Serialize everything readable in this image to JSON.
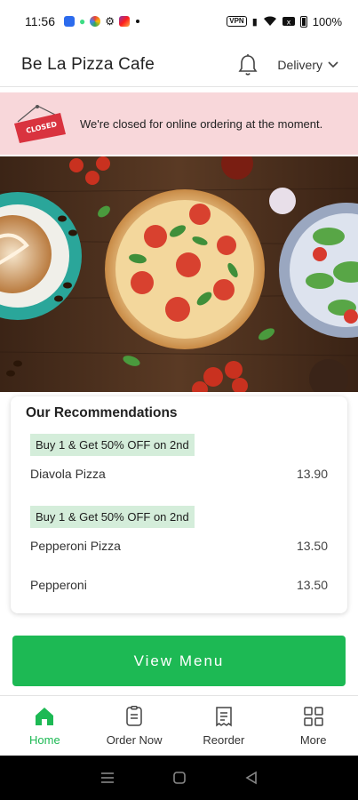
{
  "status_bar": {
    "time": "11:56",
    "vpn_label": "VPN",
    "battery": "100%"
  },
  "header": {
    "title": "Be La Pizza Cafe",
    "delivery_label": "Delivery",
    "icons": [
      "bell-icon",
      "chevron-down-icon"
    ]
  },
  "banner": {
    "sign_text": "CLOSED",
    "message": "We're closed for online ordering at the moment.",
    "background": "#f8d7da"
  },
  "recommendations": {
    "title": "Our Recommendations",
    "items": [
      {
        "promo": "Buy 1 & Get 50% OFF on 2nd",
        "name": "Diavola Pizza",
        "price": "13.90"
      },
      {
        "promo": "Buy 1 & Get 50% OFF on 2nd",
        "name": "Pepperoni Pizza",
        "price": "13.50"
      },
      {
        "promo": "",
        "name": "Pepperoni",
        "price": "13.50"
      }
    ]
  },
  "view_menu_label": "View Menu",
  "bottom_nav": [
    {
      "label": "Home",
      "icon": "home-icon",
      "active": true
    },
    {
      "label": "Order Now",
      "icon": "order-icon",
      "active": false
    },
    {
      "label": "Reorder",
      "icon": "receipt-icon",
      "active": false
    },
    {
      "label": "More",
      "icon": "grid-icon",
      "active": false
    }
  ],
  "colors": {
    "accent": "#1db954",
    "promo_bg": "#d4edda",
    "closed_sign": "#d9333f"
  }
}
